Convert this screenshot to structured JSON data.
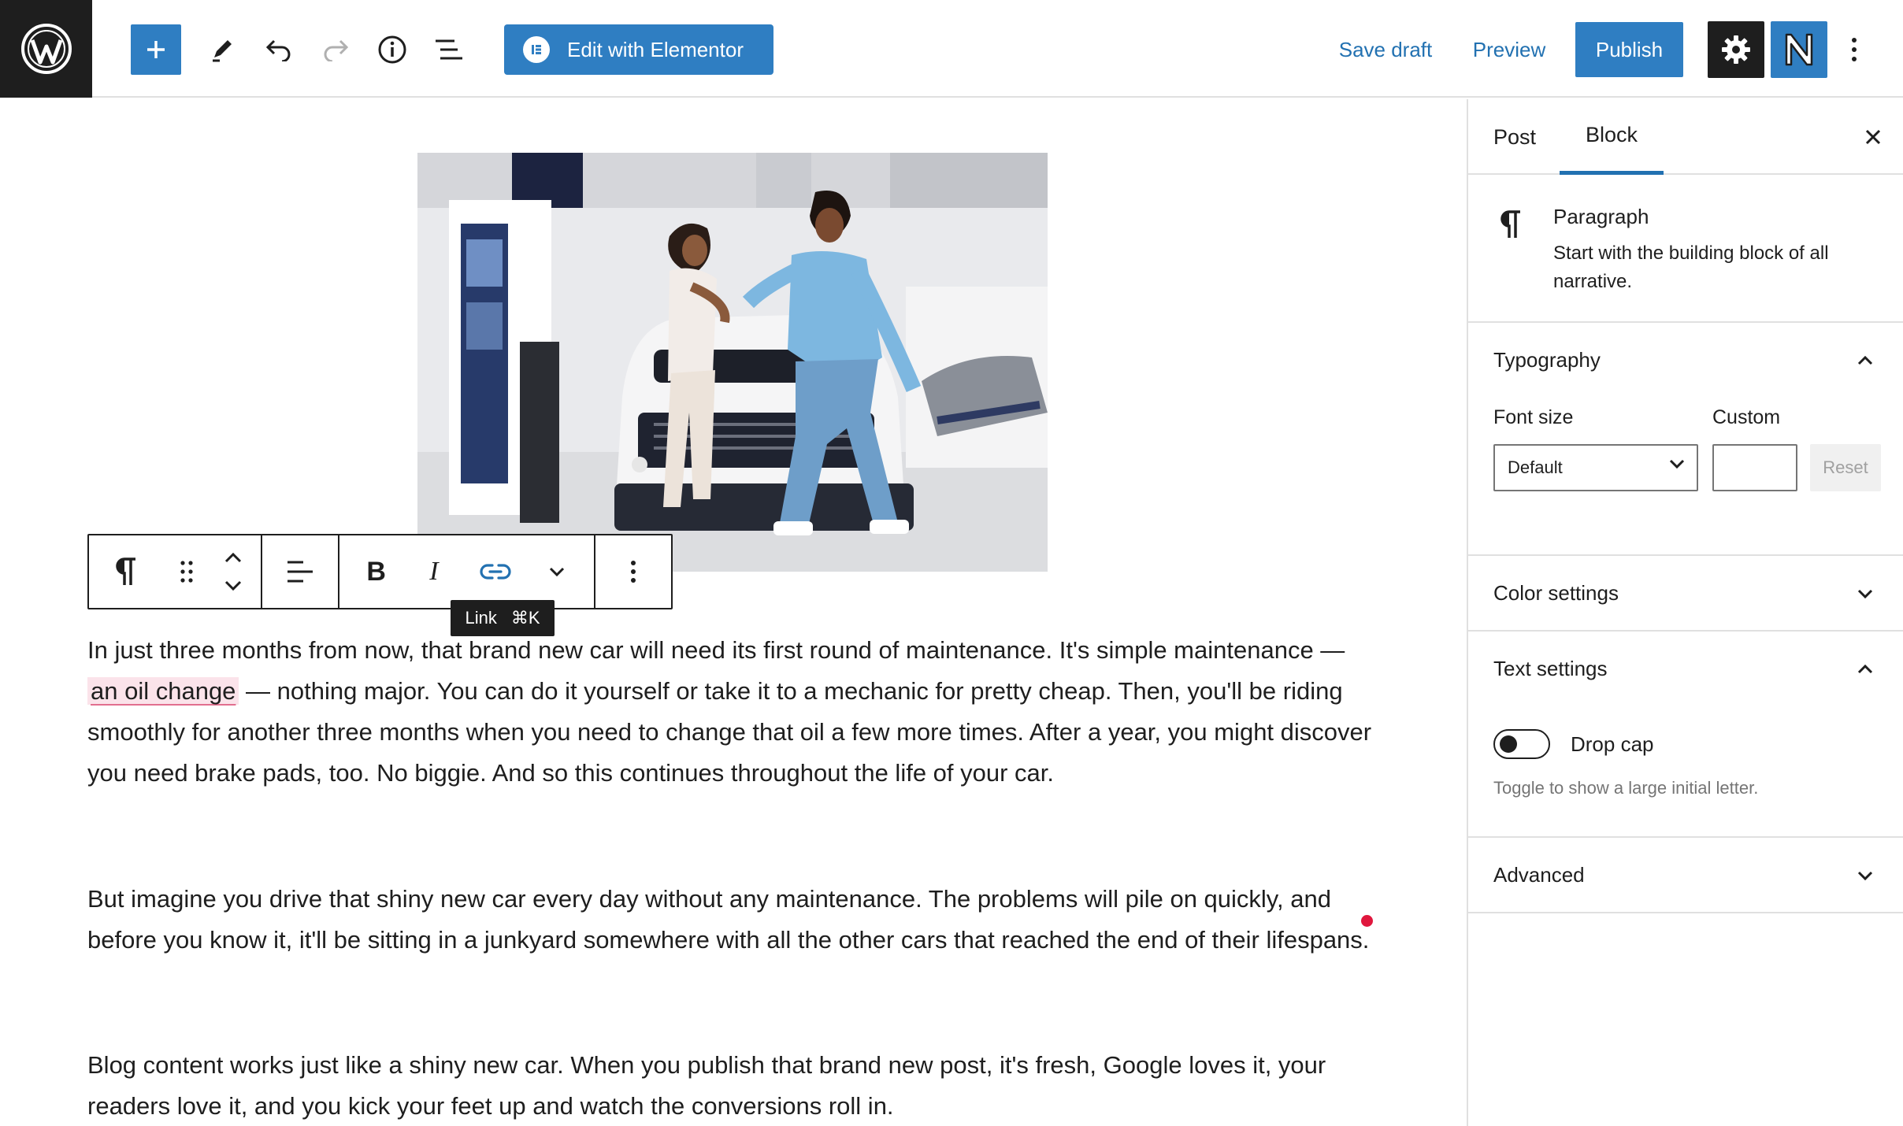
{
  "toolbar": {
    "elementor_label": "Edit with Elementor",
    "save_draft": "Save draft",
    "preview": "Preview",
    "publish": "Publish"
  },
  "block_toolbar": {
    "tooltip_label": "Link",
    "tooltip_shortcut": "⌘K"
  },
  "content": {
    "p1_before": "In just three months from now, that brand new car will need its first round of maintenance. It's simple maintenance — ",
    "p1_link": "an oil change",
    "p1_after": " — nothing major. You can do it yourself or take it to a mechanic for pretty cheap. Then, you'll be riding smoothly for another three months when you need to change that oil a few more times. After a year, you might discover you need brake pads, too. No biggie. And so this continues throughout the life of your car.",
    "p2": "But imagine you drive that shiny new car every day without any maintenance. The problems will pile on quickly, and before you know it, it'll be sitting in a junkyard somewhere with all the other cars that reached the end of their lifespans.",
    "p3": "Blog content works just like a shiny new car. When you publish that brand new post, it's fresh, Google loves it, your readers love it, and you kick your feet up and watch the conversions roll in."
  },
  "sidebar": {
    "tabs": [
      "Post",
      "Block"
    ],
    "active_tab": "Block",
    "block_title": "Paragraph",
    "block_description": "Start with the building block of all narrative.",
    "typography": {
      "title": "Typography",
      "font_size_label": "Font size",
      "custom_label": "Custom",
      "font_size_value": "Default",
      "reset_label": "Reset"
    },
    "color_settings": "Color settings",
    "text_settings": {
      "title": "Text settings",
      "drop_cap_label": "Drop cap",
      "drop_cap_help": "Toggle to show a large initial letter."
    },
    "advanced": "Advanced"
  },
  "colors": {
    "accent": "#2f7ec2",
    "link_text": "#2271b1",
    "dark": "#1e1e1e",
    "highlight": "#fbe3ea",
    "marker": "#e0173d"
  },
  "icons": [
    "wordpress-logo",
    "plus-icon",
    "pencil-icon",
    "undo-icon",
    "redo-icon",
    "info-icon",
    "list-view-icon",
    "elementor-icon",
    "gear-icon",
    "n-logo-icon",
    "kebab-icon",
    "paragraph-icon",
    "drag-handle-icon",
    "move-up-down-icon",
    "align-icon",
    "bold-icon",
    "italic-icon",
    "link-icon",
    "chevron-down-icon",
    "close-icon",
    "chevron-up-icon"
  ]
}
